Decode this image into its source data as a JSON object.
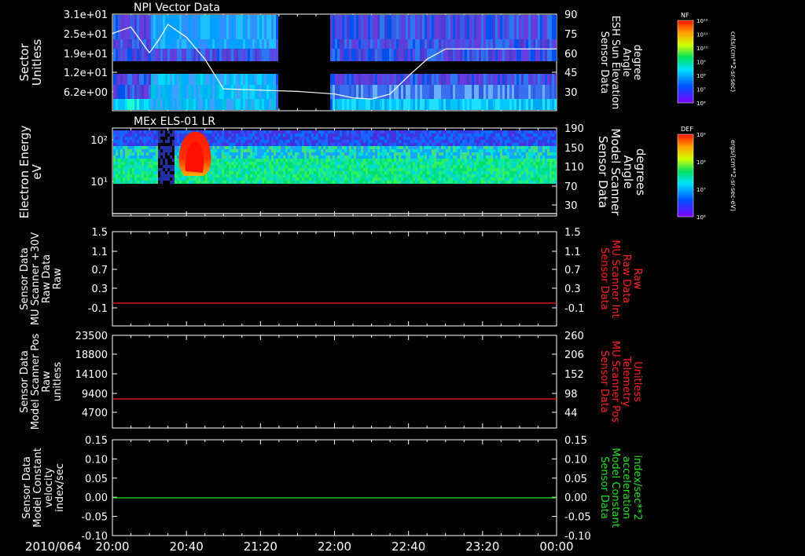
{
  "date_label": "2010/064",
  "x_ticks": [
    "20:00",
    "20:40",
    "21:20",
    "22:00",
    "22:40",
    "23:20",
    "00:00"
  ],
  "colors": {
    "white": "#ffffff",
    "red": "#ff2020",
    "green": "#20e020"
  },
  "panels": [
    {
      "title": "NPI Vector Data",
      "left_label": [
        "Sector",
        "Unitless"
      ],
      "left_ticks": [
        "3.1e+01",
        "2.5e+01",
        "1.9e+01",
        "1.2e+01",
        "6.2e+00"
      ],
      "right_ticks": [
        "90",
        "75",
        "60",
        "45",
        "30"
      ],
      "right_label": [
        "Sensor Data",
        "ESH Sun Elevation",
        "Angle",
        "degree"
      ],
      "right_label_color": "white",
      "colorbar": {
        "label": "NF",
        "ticks": [
          "10¹²",
          "10¹¹",
          "10¹⁰",
          "10⁹",
          "10⁸",
          "10⁷",
          "10⁶"
        ],
        "units": "cnts/(cm**2-sr-sec)"
      }
    },
    {
      "title": "MEx ELS-01 LR",
      "left_label": [
        "Electron Energy",
        "eV"
      ],
      "left_ticks": [
        "10²",
        "10¹"
      ],
      "right_ticks": [
        "190",
        "150",
        "110",
        "70",
        "30"
      ],
      "right_label": [
        "Sensor Data",
        "Model Scanner",
        "Angle",
        "degrees"
      ],
      "right_label_color": "white",
      "colorbar": {
        "label": "DEF",
        "ticks": [
          "10⁹",
          "10⁸",
          "10⁷",
          "10⁶"
        ],
        "units": "ergs/(cm**2-sr-sec-eV)"
      }
    },
    {
      "title": "",
      "left_label": [
        "Sensor Data",
        "MU Scanner +30V",
        "Raw Data",
        "Raw"
      ],
      "left_ticks": [
        "1.5",
        "1.1",
        "0.7",
        "0.3",
        "-0.1"
      ],
      "right_ticks": [
        "1.5",
        "1.1",
        "0.7",
        "0.3",
        "-0.1"
      ],
      "right_label": [
        "Sensor Data",
        "MU Scanner Int",
        "Raw Data",
        "Raw"
      ],
      "right_label_color": "red"
    },
    {
      "title": "",
      "left_label": [
        "Sensor Data",
        "Model Scanner Pos",
        "Raw",
        "unitless"
      ],
      "left_ticks": [
        "23500",
        "18800",
        "14100",
        "9400",
        "4700"
      ],
      "right_ticks": [
        "260",
        "206",
        "152",
        "98",
        "44"
      ],
      "right_label": [
        "Sensor Data",
        "MU Scanner Pos",
        "Telemetry",
        "Unitless"
      ],
      "right_label_color": "red"
    },
    {
      "title": "",
      "left_label": [
        "Sensor Data",
        "Model Constant",
        "velocity",
        "index/sec"
      ],
      "left_ticks": [
        "0.15",
        "0.10",
        "0.05",
        "0.00",
        "-0.05",
        "-0.10"
      ],
      "right_ticks": [
        "0.15",
        "0.10",
        "0.05",
        "0.00",
        "-0.05",
        "-0.10"
      ],
      "right_label": [
        "Sensor Data",
        "Model Constant",
        "acceleration",
        "index/sec**2"
      ],
      "right_label_color": "green"
    }
  ],
  "chart_data": [
    {
      "type": "heatmap",
      "title": "NPI Vector Data",
      "x_range": [
        "20:00",
        "00:00"
      ],
      "ylabel": "Sector Unitless",
      "y2label": "Sensor Data ESH Sun Elevation Angle degree",
      "ylim2": [
        15,
        90
      ],
      "data_gap": [
        "21:25",
        "21:55"
      ],
      "line_series": {
        "name": "ESH Sun Elevation Angle",
        "x_min": [
          0,
          10,
          20,
          25,
          30,
          40,
          50,
          60,
          80,
          100,
          120,
          130,
          140,
          150,
          160,
          170,
          180,
          240
        ],
        "y": [
          75,
          80,
          60,
          70,
          82,
          72,
          55,
          32,
          31,
          30,
          28,
          25,
          24,
          28,
          42,
          55,
          63,
          63
        ]
      }
    },
    {
      "type": "heatmap",
      "title": "MEx ELS-01 LR",
      "ylabel": "Electron Energy eV",
      "y2label": "Sensor Data Model Scanner Angle degrees",
      "ylim2": [
        10,
        190
      ],
      "y_scale": "log",
      "line_series": {
        "name": "Model Scanner Angle",
        "constant_y": 10
      }
    },
    {
      "type": "line",
      "ylim": [
        -0.3,
        1.5
      ],
      "series": [
        {
          "name": "MU Scanner Int Raw Data",
          "color": "red",
          "constant_y": 0.0
        }
      ]
    },
    {
      "type": "line",
      "ylim": [
        0,
        23500
      ],
      "ylim2": [
        0,
        260
      ],
      "series": [
        {
          "name": "MU Scanner Pos Telemetry",
          "color": "red",
          "constant_y": 84
        }
      ]
    },
    {
      "type": "line",
      "ylim": [
        -0.1,
        0.15
      ],
      "series": [
        {
          "name": "Model Constant acceleration",
          "color": "green",
          "constant_y": 0.0
        }
      ]
    }
  ]
}
